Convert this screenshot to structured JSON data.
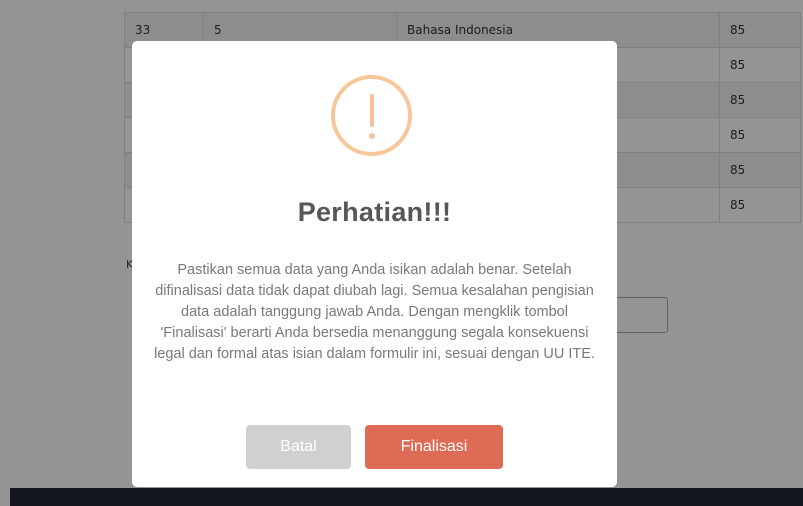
{
  "background": {
    "table_rows": [
      {
        "no": "33",
        "kelas": "5",
        "mapel": "Bahasa Indonesia",
        "nilai": "85"
      },
      {
        "no": "",
        "kelas": "",
        "mapel": "",
        "nilai": "85"
      },
      {
        "no": "",
        "kelas": "",
        "mapel": "",
        "nilai": "85"
      },
      {
        "no": "",
        "kelas": "",
        "mapel": "",
        "nilai": "85"
      },
      {
        "no": "",
        "kelas": "",
        "mapel": "",
        "nilai": "85"
      },
      {
        "no": "",
        "kelas": "",
        "mapel": "",
        "nilai": "85"
      }
    ],
    "partial_label": "K"
  },
  "modal": {
    "icon": "warning-exclamation-icon",
    "title": "Perhatian!!!",
    "message": "Pastikan semua data yang Anda isikan adalah benar. Setelah difinalisasi data tidak dapat diubah lagi. Semua kesalahan pengisian data adalah tanggung jawab Anda. Dengan mengklik tombol 'Finalisasi' berarti Anda bersedia menanggung segala konsekuensi legal dan formal atas isian dalam formulir ini, sesuai dengan UU ITE.",
    "cancel_label": "Batal",
    "confirm_label": "Finalisasi",
    "colors": {
      "icon": "#f8bb86",
      "confirm": "#dd6b55",
      "cancel": "#d0d0d0"
    }
  }
}
